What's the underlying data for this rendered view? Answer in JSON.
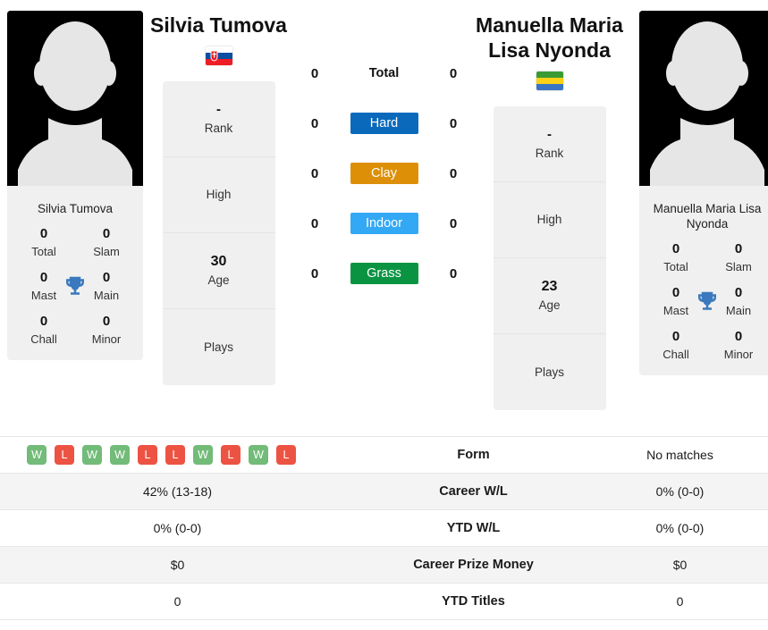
{
  "players": {
    "left": {
      "name": "Silvia Tumova",
      "card_name": "Silvia Tumova",
      "country": "Slovakia",
      "flag_icon": "flag-slovakia",
      "avatar_icon": "avatar-placeholder",
      "trophies": [
        {
          "value": "0",
          "label": "Total"
        },
        {
          "value": "0",
          "label": "Slam"
        },
        {
          "value": "0",
          "label": "Mast"
        },
        {
          "value": "0",
          "label": "Main"
        },
        {
          "value": "0",
          "label": "Chall"
        },
        {
          "value": "0",
          "label": "Minor"
        }
      ],
      "trophy_icon": "trophy-icon",
      "info": [
        {
          "value": "-",
          "label": "Rank"
        },
        {
          "value": "",
          "label": "High"
        },
        {
          "value": "30",
          "label": "Age"
        },
        {
          "value": "",
          "label": "Plays"
        }
      ]
    },
    "right": {
      "name": "Manuella Maria Lisa Nyonda",
      "card_name": "Manuella Maria Lisa Nyonda",
      "country": "Gabon",
      "flag_icon": "flag-gabon",
      "avatar_icon": "avatar-placeholder",
      "trophies": [
        {
          "value": "0",
          "label": "Total"
        },
        {
          "value": "0",
          "label": "Slam"
        },
        {
          "value": "0",
          "label": "Mast"
        },
        {
          "value": "0",
          "label": "Main"
        },
        {
          "value": "0",
          "label": "Chall"
        },
        {
          "value": "0",
          "label": "Minor"
        }
      ],
      "trophy_icon": "trophy-icon",
      "info": [
        {
          "value": "-",
          "label": "Rank"
        },
        {
          "value": "",
          "label": "High"
        },
        {
          "value": "23",
          "label": "Age"
        },
        {
          "value": "",
          "label": "Plays"
        }
      ]
    }
  },
  "surfaces": [
    {
      "label": "Total",
      "left": "0",
      "right": "0",
      "color": "",
      "style": "plain"
    },
    {
      "label": "Hard",
      "left": "0",
      "right": "0",
      "color": "#0b69bc",
      "style": "colored"
    },
    {
      "label": "Clay",
      "left": "0",
      "right": "0",
      "color": "#dd9007",
      "style": "colored"
    },
    {
      "label": "Indoor",
      "left": "0",
      "right": "0",
      "color": "#33a8f5",
      "style": "colored"
    },
    {
      "label": "Grass",
      "left": "0",
      "right": "0",
      "color": "#0a9442",
      "style": "colored"
    }
  ],
  "form": {
    "left_results": [
      "W",
      "L",
      "W",
      "W",
      "L",
      "L",
      "W",
      "L",
      "W",
      "L"
    ],
    "right_text": "No matches",
    "win_color": "#72bb78",
    "loss_color": "#ed5343"
  },
  "table_rows": [
    {
      "label": "Form",
      "left": "",
      "right": "No matches",
      "type": "form"
    },
    {
      "label": "Career W/L",
      "left": "42% (13-18)",
      "right": "0% (0-0)",
      "type": "text"
    },
    {
      "label": "YTD W/L",
      "left": "0% (0-0)",
      "right": "0% (0-0)",
      "type": "text"
    },
    {
      "label": "Career Prize Money",
      "left": "$0",
      "right": "$0",
      "type": "text"
    },
    {
      "label": "YTD Titles",
      "left": "0",
      "right": "0",
      "type": "text"
    }
  ]
}
